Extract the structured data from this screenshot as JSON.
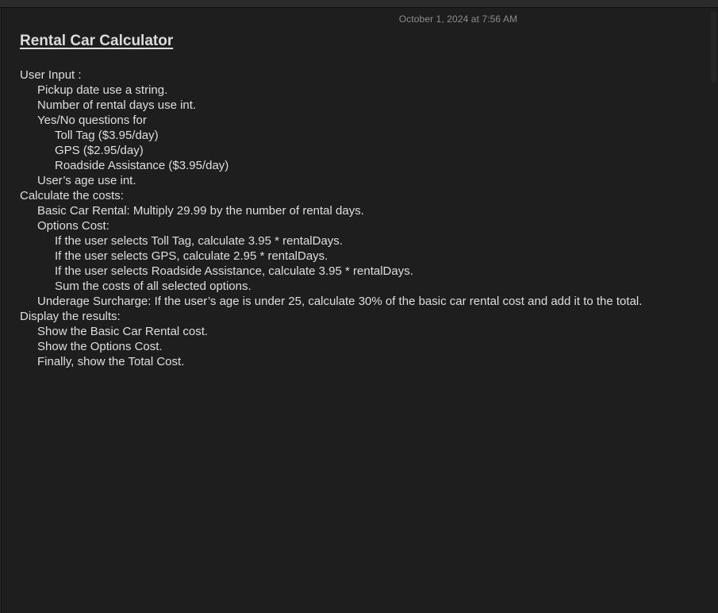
{
  "note": {
    "timestamp": "October 1, 2024 at 7:56 AM",
    "title": "Rental Car Calculator",
    "lines": [
      {
        "text": "User Input :",
        "indent": 0
      },
      {
        "text": "Pickup date use a string.",
        "indent": 1
      },
      {
        "text": "Number of rental days use int.",
        "indent": 1
      },
      {
        "text": "Yes/No questions for",
        "indent": 1
      },
      {
        "text": "Toll Tag ($3.95/day)",
        "indent": 2
      },
      {
        "text": "GPS ($2.95/day)",
        "indent": 2
      },
      {
        "text": "Roadside Assistance ($3.95/day)",
        "indent": 2
      },
      {
        "text": "User’s age use int.",
        "indent": 1
      },
      {
        "text": "Calculate the costs:",
        "indent": 0
      },
      {
        "text": "Basic Car Rental: Multiply 29.99 by the number of rental days.",
        "indent": 1
      },
      {
        "text": "Options Cost:",
        "indent": 1
      },
      {
        "text": "If the user selects Toll Tag, calculate 3.95 * rentalDays.",
        "indent": 2
      },
      {
        "text": "If the user selects GPS, calculate 2.95 * rentalDays.",
        "indent": 2
      },
      {
        "text": "If the user selects Roadside Assistance, calculate 3.95 * rentalDays.",
        "indent": 2
      },
      {
        "text": "Sum the costs of all selected options.",
        "indent": 2
      },
      {
        "text": "Underage Surcharge: If the user’s age is under 25, calculate 30% of the basic car rental cost and add it to the total.",
        "indent": 1
      },
      {
        "text": "Display the results:",
        "indent": 0
      },
      {
        "text": "Show the Basic Car Rental cost.",
        "indent": 1
      },
      {
        "text": "Show the Options Cost.",
        "indent": 1
      },
      {
        "text": "Finally, show the Total Cost.",
        "indent": 1
      }
    ]
  },
  "colors": {
    "background": "#1e1e1e",
    "text": "#dfdfdf",
    "timestamp": "#8d8d8d"
  }
}
